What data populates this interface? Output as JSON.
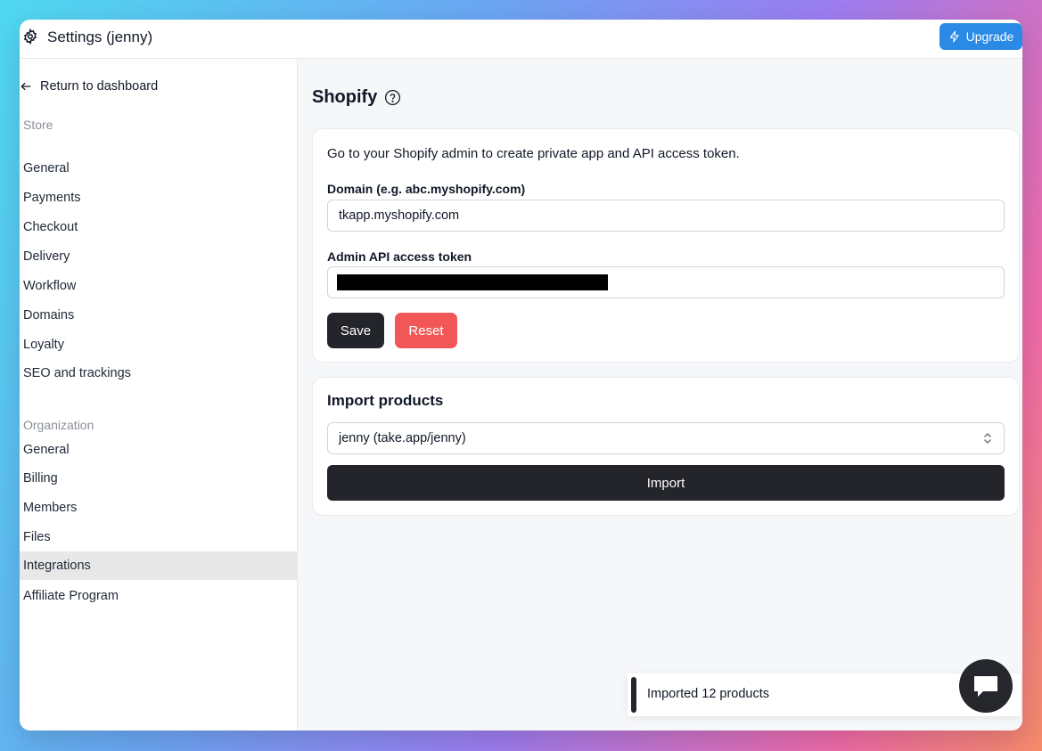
{
  "window": {
    "title": "Settings (jenny)",
    "upgrade_label": "Upgrade"
  },
  "sidebar": {
    "back_label": "Return to dashboard",
    "store_label": "Store",
    "store_items": [
      "General",
      "Payments",
      "Checkout",
      "Delivery",
      "Workflow",
      "Domains",
      "Loyalty",
      "SEO and trackings"
    ],
    "org_label": "Organization",
    "org_items": [
      "General",
      "Billing",
      "Members",
      "Files",
      "Integrations",
      "Affiliate Program"
    ],
    "active_item": "Integrations"
  },
  "main": {
    "title": "Shopify",
    "shopify_card": {
      "intro": "Go to your Shopify admin to create private app and API access token.",
      "domain_label": "Domain (e.g. abc.myshopify.com)",
      "domain_value": "tkapp.myshopify.com",
      "token_label": "Admin API access token",
      "save_label": "Save",
      "reset_label": "Reset"
    },
    "import_card": {
      "title": "Import products",
      "selected_store": "jenny (take.app/jenny)",
      "import_label": "Import"
    }
  },
  "toast": {
    "message": "Imported 12 products"
  },
  "colors": {
    "primary_dark": "#23252b",
    "upgrade_blue": "#2b8ae6",
    "reset_red": "#f25757",
    "active_nav_bg": "#e8e8e8"
  },
  "icons": {
    "settings": "gear-icon",
    "upgrade": "lightning-icon",
    "back": "arrow-left-icon",
    "help": "question-circle-icon",
    "select": "chevron-up-down-icon",
    "chat": "chat-bubble-icon"
  }
}
